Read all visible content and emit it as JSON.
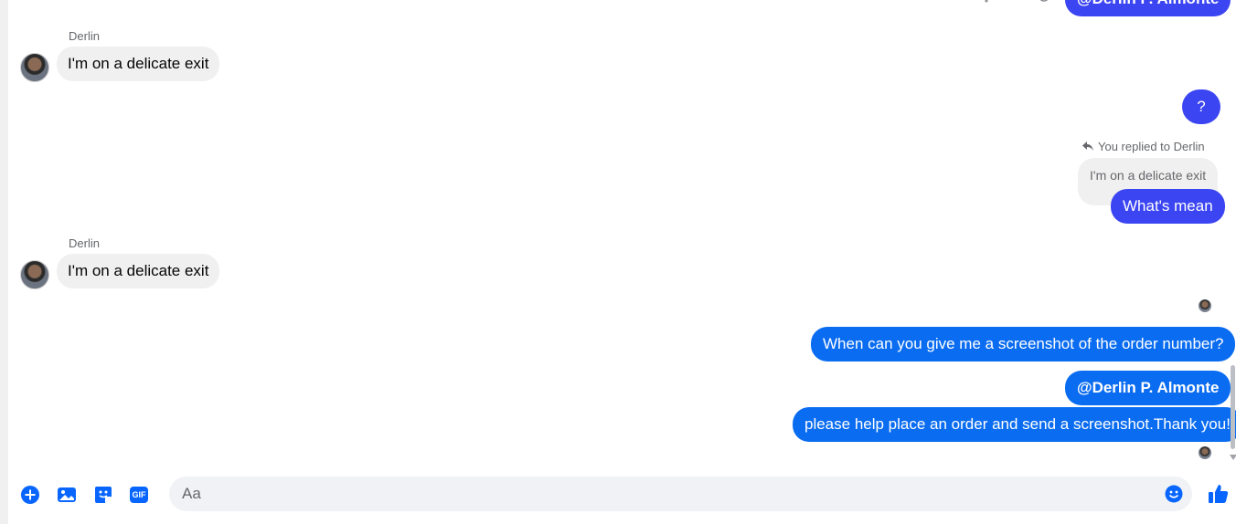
{
  "top_partial": {
    "mention": "@Derlin P. Almonte"
  },
  "messages": {
    "in1": {
      "sender": "Derlin",
      "text": "I'm on a delicate exit"
    },
    "out_question": {
      "text": "?"
    },
    "reply": {
      "note": "You replied to Derlin",
      "quoted": "I'm on a delicate exit",
      "text": "What's mean"
    },
    "in2": {
      "sender": "Derlin",
      "text": "I'm on a delicate exit"
    },
    "out1": {
      "text": "When can you give me a screenshot of the order number?"
    },
    "out2": {
      "text": "@Derlin P. Almonte"
    },
    "out3": {
      "text": "please help place an order and send a screenshot.Thank you!"
    }
  },
  "composer": {
    "placeholder": "Aa",
    "gif_label": "GIF"
  },
  "colors": {
    "accent": "#0a6cf0",
    "violet": "#3b45f2",
    "incoming_bg": "#f0f0f0",
    "icon": "#0866ff"
  },
  "icons": [
    "more-icon",
    "reply-icon",
    "react-icon",
    "reply-arrow-icon",
    "add-icon",
    "image-icon",
    "sticker-icon",
    "gif-icon",
    "emoji-icon",
    "like-icon"
  ]
}
